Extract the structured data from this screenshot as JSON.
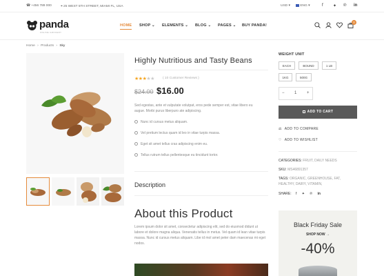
{
  "topbar": {
    "phone": "+456 789 000",
    "address": "25 WEST 5TH STREET, MIAMI FL, USA",
    "currency": "USD",
    "language": "ENG"
  },
  "header": {
    "logo_text": "panda",
    "tagline": "ONLINE GROCERY",
    "nav": [
      {
        "label": "HOME",
        "has_caret": false
      },
      {
        "label": "SHOP",
        "has_caret": true
      },
      {
        "label": "ELEMENTS",
        "has_caret": true
      },
      {
        "label": "BLOG",
        "has_caret": true
      },
      {
        "label": "PAGES",
        "has_caret": true
      },
      {
        "label": "BUY PANDA!",
        "has_caret": false
      }
    ],
    "cart_count": "0"
  },
  "breadcrumb": {
    "home": "Home",
    "products": "Products",
    "current": "Sky"
  },
  "product": {
    "title": "Highly Nutritious and Tasty Beans",
    "rating": 3,
    "reviews": "( 10 Customer Reviews )",
    "price_old": "$24.00",
    "price_new": "$16.00",
    "description": "Sed egestas, ante et vulputate volutpat, eros pede semper est, vitae libero eu augue. Morbi purus liberpuro ate adipiscing.",
    "features": [
      "Nunc id cursus metus aliquam.",
      "Vel pretium lectus quam id leo in vitae turpis massa.",
      "Eget sit amet tellus cras adipiscing enim eu.",
      "Tellus rutrum tellus pellentesque eu tincidunt tortor."
    ]
  },
  "options": {
    "weight_label": "WEIGHT UNIT",
    "weights": [
      "EACH",
      "BOUND",
      "1 LB",
      "1KG",
      "500G"
    ],
    "qty": "1",
    "add_to_cart": "ADD TO CART",
    "compare": "ADD TO COMPARE",
    "wishlist": "ADD TO WISHLIST"
  },
  "meta": {
    "categories_label": "CATEGORIES:",
    "categories": "FRUIT, DAILY NEEDS",
    "sku_label": "SKU:",
    "sku": "MS46891357",
    "tags_label": "TAGS:",
    "tags": "ORGANIC, GREENHOUSE, FAT, HEALTHY, DAIRY, VITAMIN,",
    "share_label": "SHARE:"
  },
  "tabs": {
    "description": "Description"
  },
  "about": {
    "heading": "About this Product",
    "text": "Lorem ipsum dolor sit amet, consectetur adipiscing elit, sed do eiusmod didunt ut labore et dolore magna aliqua. Venenatis tellus in metus. Vel quam id lean vitae turpis massa. Nunc id cursus metus aliquam. Libe id mol amet peter dam maecenas mi eget nodos."
  },
  "banner": {
    "title": "Black Friday Sale",
    "link": "SHOP NOW",
    "discount": "-40%"
  },
  "colors": {
    "accent": "#e58a3a",
    "cart_button": "#595959",
    "star": "#f5a623"
  }
}
